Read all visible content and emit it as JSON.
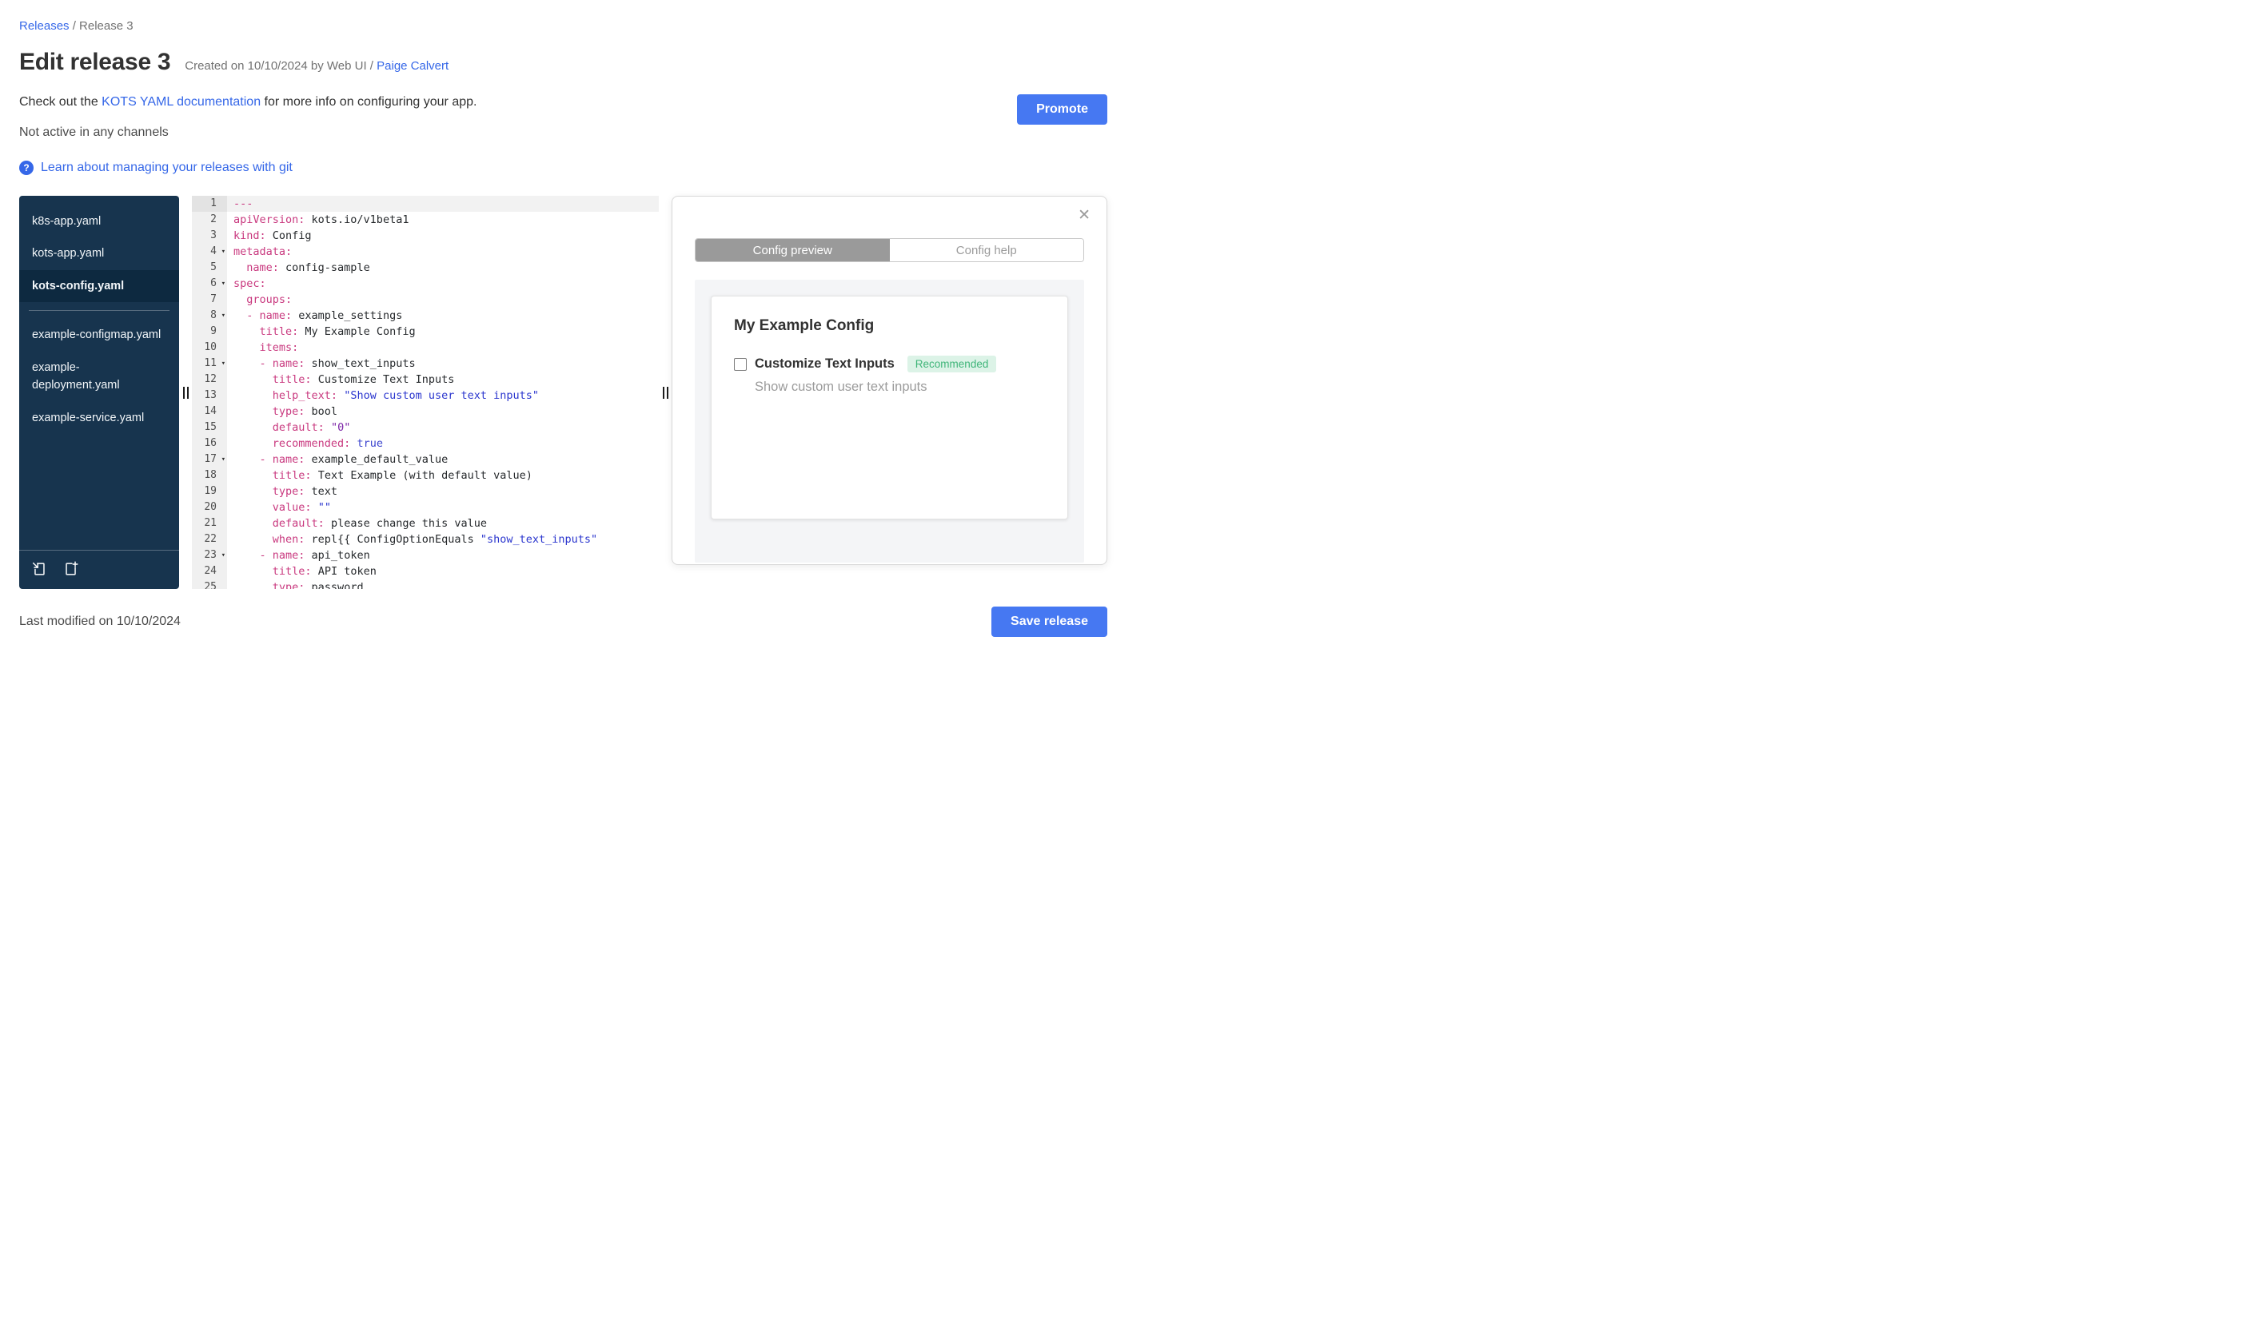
{
  "colors": {
    "link_blue": "#3567E8",
    "button_blue": "#4678F2",
    "sidebar_bg": "#17344E",
    "sidebar_selected_bg": "#0D2940",
    "code_plain": "#26292C",
    "code_key": "#C9397F",
    "code_string": "#2A35CE",
    "code_bool": "#3B44CE",
    "code_quoted": "#7D26A8",
    "tab_active_bg": "#9A9A9A",
    "badge_bg": "#DCF3E7",
    "badge_text": "#3FB579"
  },
  "breadcrumb": {
    "releases_link": "Releases",
    "rest": " / Release 3"
  },
  "header": {
    "title": "Edit release 3",
    "created_text": "Created on 10/10/2024 by Web UI / ",
    "created_author": "Paige Calvert",
    "doc_prefix": "Check out the ",
    "doc_link": "KOTS YAML documentation",
    "doc_suffix": " for more info on configuring your app.",
    "channel_status": "Not active in any channels",
    "promote_button": "Promote",
    "help_icon": "?",
    "git_link": "Learn about managing your releases with git"
  },
  "file_tree": {
    "items": [
      {
        "label": "k8s-app.yaml",
        "selected": false
      },
      {
        "label": "kots-app.yaml",
        "selected": false
      },
      {
        "label": "kots-config.yaml",
        "selected": true
      },
      {
        "label": "example-configmap.yaml",
        "selected": false,
        "divider_before": true
      },
      {
        "label": "example-deployment.yaml",
        "selected": false
      },
      {
        "label": "example-service.yaml",
        "selected": false
      }
    ],
    "bottom_icons": [
      "import-file-icon",
      "new-file-icon"
    ]
  },
  "editor": {
    "lines": [
      {
        "num": 1,
        "active": true,
        "tokens": [
          {
            "c": "k",
            "t": "---"
          }
        ]
      },
      {
        "num": 2,
        "tokens": [
          {
            "c": "k",
            "t": "apiVersion:"
          },
          {
            "c": "p",
            "t": " kots.io/v1beta1"
          }
        ]
      },
      {
        "num": 3,
        "tokens": [
          {
            "c": "k",
            "t": "kind:"
          },
          {
            "c": "p",
            "t": " Config"
          }
        ]
      },
      {
        "num": 4,
        "fold": true,
        "tokens": [
          {
            "c": "k",
            "t": "metadata:"
          }
        ]
      },
      {
        "num": 5,
        "tokens": [
          {
            "c": "p",
            "t": "  "
          },
          {
            "c": "k",
            "t": "name:"
          },
          {
            "c": "p",
            "t": " config-sample"
          }
        ]
      },
      {
        "num": 6,
        "fold": true,
        "tokens": [
          {
            "c": "k",
            "t": "spec:"
          }
        ]
      },
      {
        "num": 7,
        "tokens": [
          {
            "c": "p",
            "t": "  "
          },
          {
            "c": "k",
            "t": "groups:"
          }
        ]
      },
      {
        "num": 8,
        "fold": true,
        "tokens": [
          {
            "c": "p",
            "t": "  "
          },
          {
            "c": "k",
            "t": "- name:"
          },
          {
            "c": "p",
            "t": " example_settings"
          }
        ]
      },
      {
        "num": 9,
        "tokens": [
          {
            "c": "p",
            "t": "    "
          },
          {
            "c": "k",
            "t": "title:"
          },
          {
            "c": "p",
            "t": " My Example Config"
          }
        ]
      },
      {
        "num": 10,
        "tokens": [
          {
            "c": "p",
            "t": "    "
          },
          {
            "c": "k",
            "t": "items:"
          }
        ]
      },
      {
        "num": 11,
        "fold": true,
        "tokens": [
          {
            "c": "p",
            "t": "    "
          },
          {
            "c": "k",
            "t": "- name:"
          },
          {
            "c": "p",
            "t": " show_text_inputs"
          }
        ]
      },
      {
        "num": 12,
        "tokens": [
          {
            "c": "p",
            "t": "      "
          },
          {
            "c": "k",
            "t": "title:"
          },
          {
            "c": "p",
            "t": " Customize Text Inputs"
          }
        ]
      },
      {
        "num": 13,
        "tokens": [
          {
            "c": "p",
            "t": "      "
          },
          {
            "c": "k",
            "t": "help_text:"
          },
          {
            "c": "p",
            "t": " "
          },
          {
            "c": "s",
            "t": "\"Show custom user text inputs\""
          }
        ]
      },
      {
        "num": 14,
        "tokens": [
          {
            "c": "p",
            "t": "      "
          },
          {
            "c": "k",
            "t": "type:"
          },
          {
            "c": "p",
            "t": " bool"
          }
        ]
      },
      {
        "num": 15,
        "tokens": [
          {
            "c": "p",
            "t": "      "
          },
          {
            "c": "k",
            "t": "default:"
          },
          {
            "c": "p",
            "t": " "
          },
          {
            "c": "q",
            "t": "\"0\""
          }
        ]
      },
      {
        "num": 16,
        "tokens": [
          {
            "c": "p",
            "t": "      "
          },
          {
            "c": "k",
            "t": "recommended:"
          },
          {
            "c": "p",
            "t": " "
          },
          {
            "c": "b",
            "t": "true"
          }
        ]
      },
      {
        "num": 17,
        "fold": true,
        "tokens": [
          {
            "c": "p",
            "t": "    "
          },
          {
            "c": "k",
            "t": "- name:"
          },
          {
            "c": "p",
            "t": " example_default_value"
          }
        ]
      },
      {
        "num": 18,
        "tokens": [
          {
            "c": "p",
            "t": "      "
          },
          {
            "c": "k",
            "t": "title:"
          },
          {
            "c": "p",
            "t": " Text Example (with default value)"
          }
        ]
      },
      {
        "num": 19,
        "tokens": [
          {
            "c": "p",
            "t": "      "
          },
          {
            "c": "k",
            "t": "type:"
          },
          {
            "c": "p",
            "t": " text"
          }
        ]
      },
      {
        "num": 20,
        "tokens": [
          {
            "c": "p",
            "t": "      "
          },
          {
            "c": "k",
            "t": "value:"
          },
          {
            "c": "p",
            "t": " "
          },
          {
            "c": "s",
            "t": "\"\""
          }
        ]
      },
      {
        "num": 21,
        "tokens": [
          {
            "c": "p",
            "t": "      "
          },
          {
            "c": "k",
            "t": "default:"
          },
          {
            "c": "p",
            "t": " please change this value"
          }
        ]
      },
      {
        "num": 22,
        "tokens": [
          {
            "c": "p",
            "t": "      "
          },
          {
            "c": "k",
            "t": "when:"
          },
          {
            "c": "p",
            "t": " repl{{ ConfigOptionEquals "
          },
          {
            "c": "s",
            "t": "\"show_text_inputs\""
          }
        ]
      },
      {
        "num": 23,
        "fold": true,
        "tokens": [
          {
            "c": "p",
            "t": "    "
          },
          {
            "c": "k",
            "t": "- name:"
          },
          {
            "c": "p",
            "t": " api_token"
          }
        ]
      },
      {
        "num": 24,
        "tokens": [
          {
            "c": "p",
            "t": "      "
          },
          {
            "c": "k",
            "t": "title:"
          },
          {
            "c": "p",
            "t": " API token"
          }
        ]
      },
      {
        "num": 25,
        "tokens": [
          {
            "c": "p",
            "t": "      "
          },
          {
            "c": "k",
            "t": "type:"
          },
          {
            "c": "p",
            "t": " password"
          }
        ]
      }
    ]
  },
  "preview": {
    "close_icon": "✕",
    "tabs": [
      {
        "label": "Config preview",
        "active": true
      },
      {
        "label": "Config help",
        "active": false
      }
    ],
    "card": {
      "heading": "My Example Config",
      "option_label": "Customize Text Inputs",
      "badge": "Recommended",
      "option_help": "Show custom user text inputs",
      "checkbox_checked": false
    }
  },
  "footer": {
    "last_modified": "Last modified on 10/10/2024",
    "save_button": "Save release"
  }
}
